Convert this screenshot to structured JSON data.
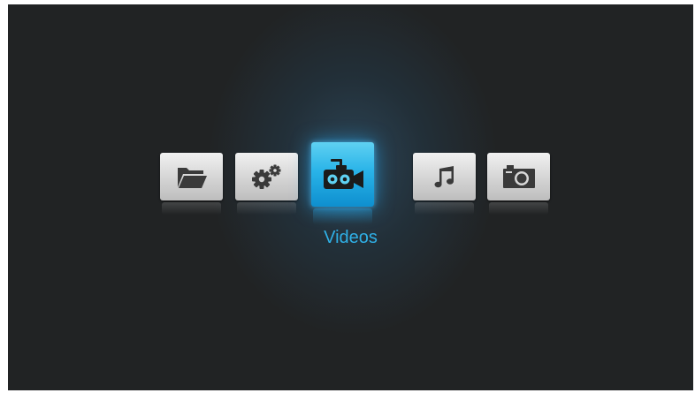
{
  "menu": {
    "items": [
      {
        "name": "folders",
        "icon": "folder-icon"
      },
      {
        "name": "settings",
        "icon": "gears-icon"
      },
      {
        "name": "videos",
        "icon": "video-camera-icon"
      },
      {
        "name": "music",
        "icon": "music-note-icon"
      },
      {
        "name": "photos",
        "icon": "camera-icon"
      }
    ],
    "selected_label": "Videos",
    "accent_color": "#29b3e8"
  }
}
